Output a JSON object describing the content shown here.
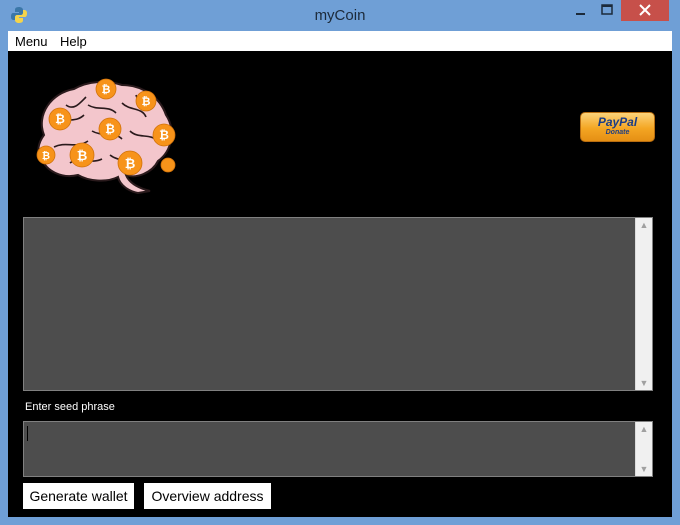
{
  "window": {
    "title": "myCoin",
    "icon": "python-icon",
    "controls": [
      "minimize-icon",
      "maximize-icon",
      "close-icon"
    ]
  },
  "menubar": {
    "items": [
      {
        "label": "Menu"
      },
      {
        "label": "Help"
      }
    ]
  },
  "header": {
    "logo": "brain-bitcoin-logo",
    "donate": {
      "brand": "PayPal",
      "label": "Donate"
    }
  },
  "output": {
    "value": ""
  },
  "seed": {
    "label": "Enter seed phrase",
    "value": ""
  },
  "buttons": {
    "generate": "Generate wallet",
    "overview": "Overview address"
  },
  "colors": {
    "titlebar": "#6f9fd6",
    "client_bg": "#000000",
    "field_bg": "#4d4d4d",
    "close_button": "#c7504a",
    "bitcoin_orange": "#f7931a",
    "brain_pink": "#f3c6cc"
  }
}
